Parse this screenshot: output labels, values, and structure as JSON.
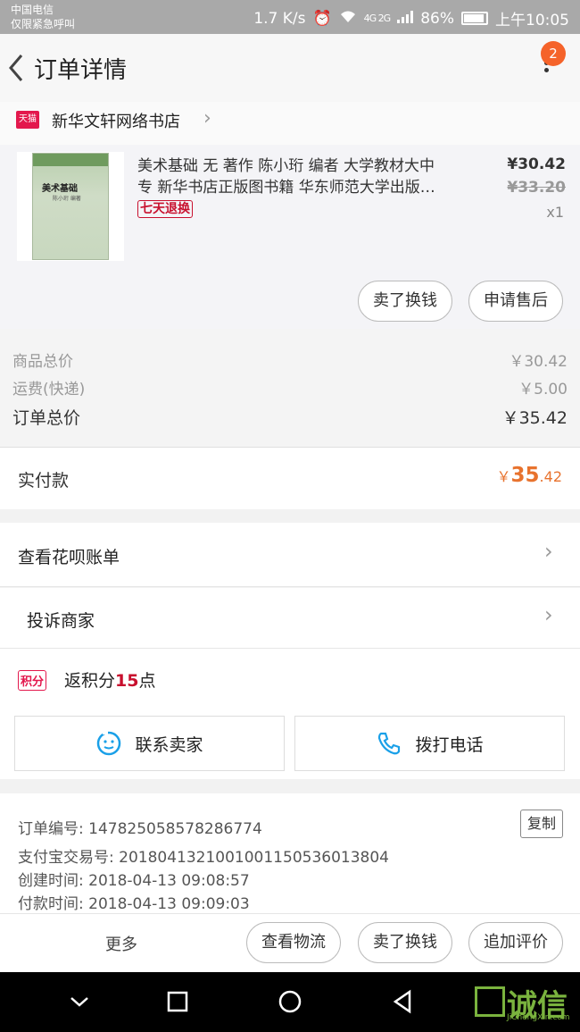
{
  "status_bar": {
    "carrier": "中国电信",
    "carrier_sub": "仅限紧急呼叫",
    "speed": "1.7 K/s",
    "network": "4G 2G",
    "battery": "86%",
    "time": "上午10:05"
  },
  "header": {
    "title": "订单详情",
    "badge_count": "2"
  },
  "shop": {
    "badge": "天猫",
    "name": "新华文轩网络书店"
  },
  "product": {
    "cover_title": "美术基础",
    "cover_sub": "陈小珩 编著",
    "name_line1": "美术基础 无 著作 陈小珩 编者 大学教材大中",
    "name_line2": "专 新华书店正版图书籍 华东师范大学出版…",
    "return_tag": "七天退换",
    "price": "¥30.42",
    "old_price": "¥33.20",
    "qty": "x1",
    "sell_label": "卖了换钱",
    "aftersale_label": "申请售后"
  },
  "summary": {
    "goods_label": "商品总价",
    "goods_value": "￥30.42",
    "shipping_label": "运费(快递)",
    "shipping_value": "￥5.00",
    "total_label": "订单总价",
    "total_value": "￥35.42",
    "paid_label": "实付款",
    "paid_currency": "￥",
    "paid_int": "35",
    "paid_dec": ".42"
  },
  "links": {
    "huabei": "查看花呗账单",
    "complain": "投诉商家"
  },
  "points": {
    "tag": "积分",
    "prefix": "返积分",
    "num": "15",
    "suffix": "点"
  },
  "actions": {
    "contact": "联系卖家",
    "call": "拨打电话"
  },
  "order_info": {
    "order_no": "订单编号: 147825058578286774",
    "copy": "复制",
    "alipay_no": "支付宝交易号: 2018041321001001150536013804",
    "created": "创建时间: 2018-04-13 09:08:57",
    "paid": "付款时间: 2018-04-13 09:09:03"
  },
  "bottom_bar": {
    "more": "更多",
    "logistics": "查看物流",
    "sell": "卖了换钱",
    "review": "追加评价"
  },
  "watermark": {
    "text": "诚信",
    "url": "JiChengXin.com"
  },
  "colors": {
    "accent": "#e8732e",
    "badge": "#f5632a",
    "tmall": "#e3184d"
  }
}
